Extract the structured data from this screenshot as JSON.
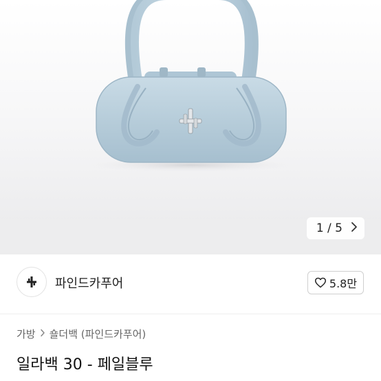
{
  "image": {
    "counter_text": "1 / 5",
    "next_icon": "chevron-right-icon",
    "bag_color": "#b9cfdc"
  },
  "shop": {
    "name": "파인드카푸어",
    "like_count": "5.8만",
    "like_icon": "heart-outline-icon"
  },
  "breadcrumb": {
    "items": [
      "가방",
      "숄더백 (파인드카푸어)"
    ],
    "separator_icon": "chevron-right-icon"
  },
  "product": {
    "title": "일라백 30 - 페일블루"
  }
}
